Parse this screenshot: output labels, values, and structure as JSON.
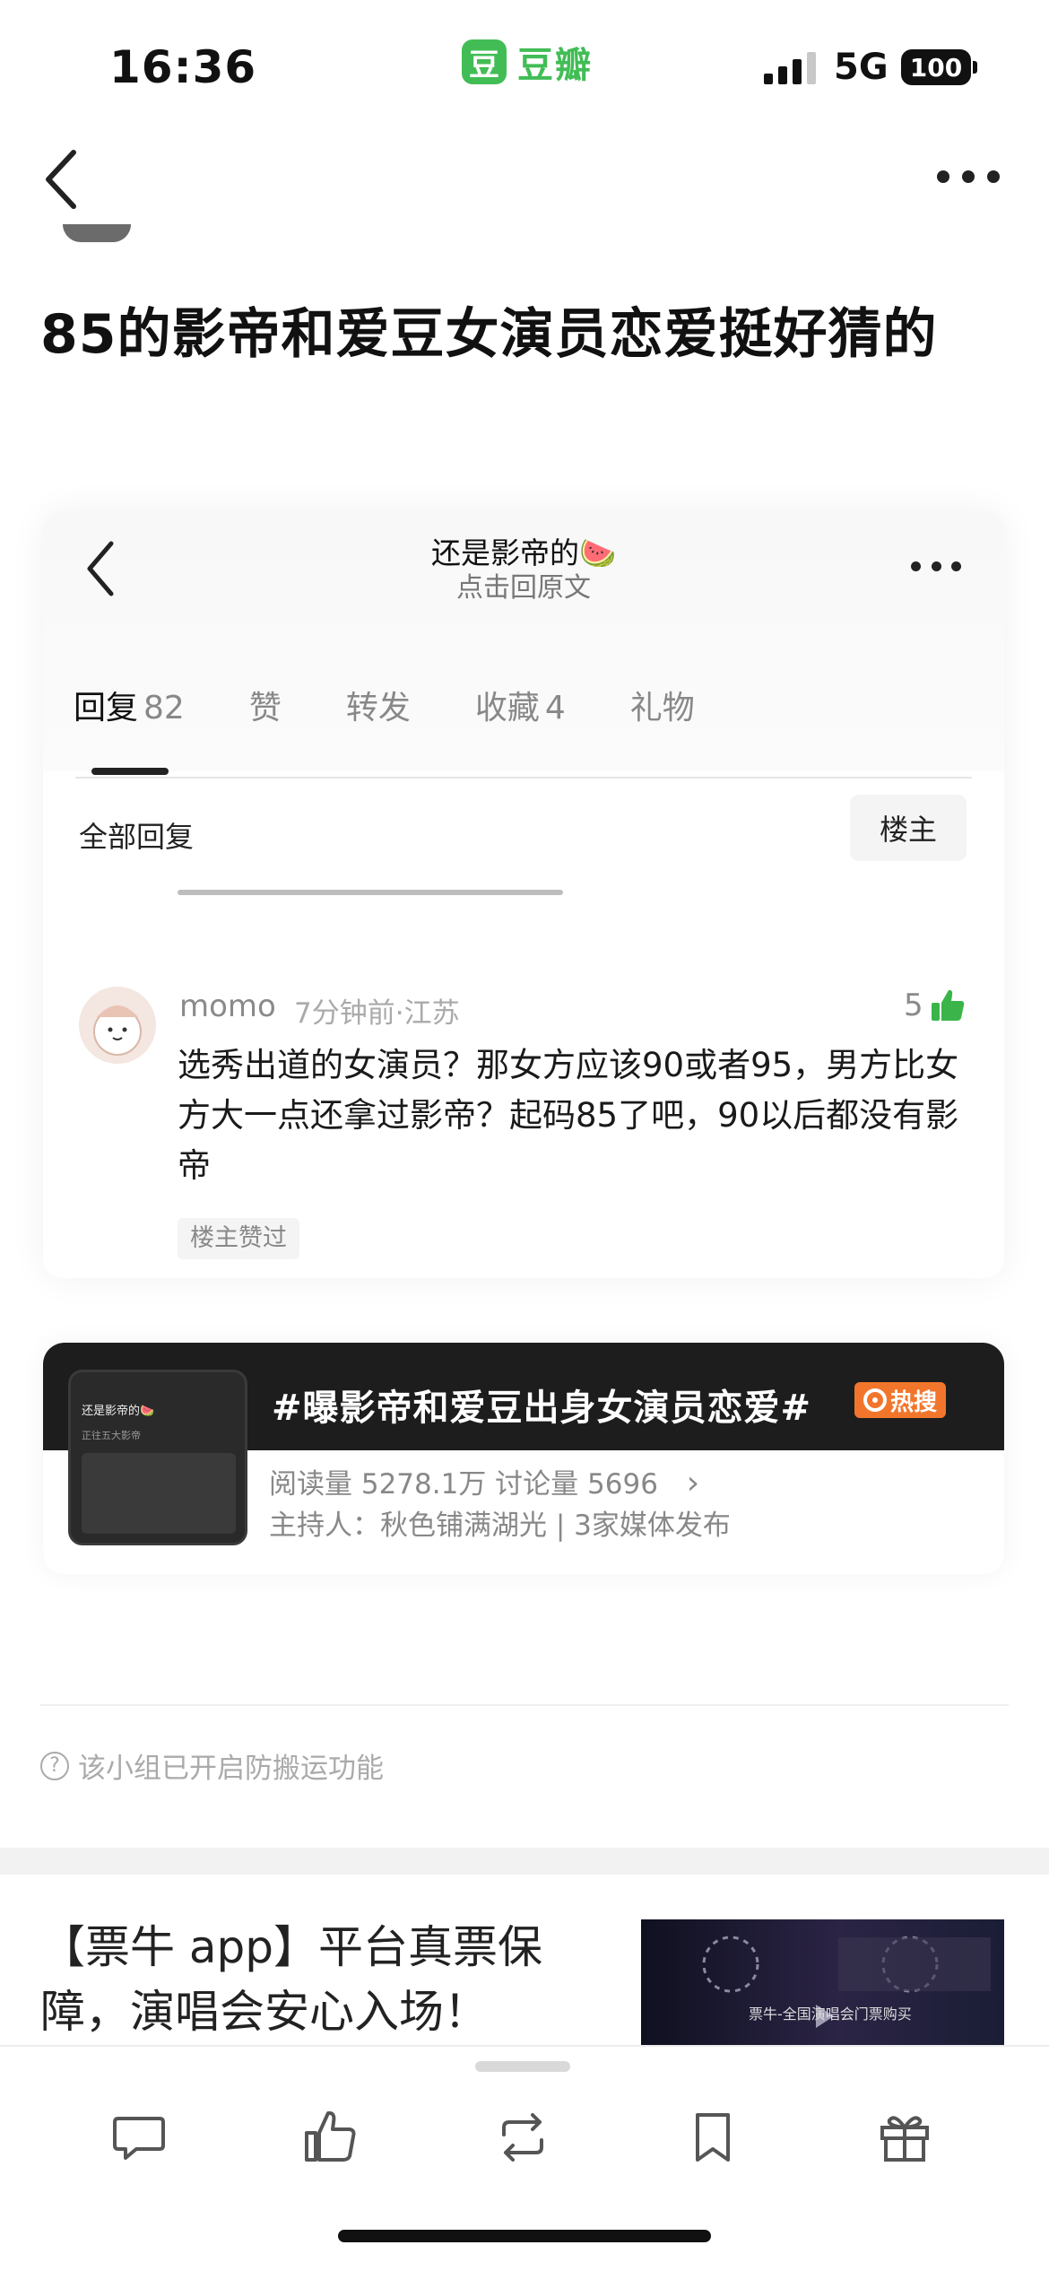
{
  "status_bar": {
    "time": "16:36",
    "app_logo_char": "豆",
    "app_name": "豆瓣",
    "network": "5G",
    "battery": "100"
  },
  "post": {
    "title": "85的影帝和爱豆女演员恋爱挺好猜的"
  },
  "screenshot": {
    "title": "还是影帝的🍉",
    "subtitle": "点击回原文",
    "tabs": [
      {
        "label": "回复",
        "count": "82"
      },
      {
        "label": "赞",
        "count": ""
      },
      {
        "label": "转发",
        "count": ""
      },
      {
        "label": "收藏",
        "count": "4"
      },
      {
        "label": "礼物",
        "count": ""
      }
    ],
    "filter_label": "全部回复",
    "filter_button": "楼主",
    "comment": {
      "author": "momo",
      "meta": "7分钟前·江苏",
      "likes": "5",
      "text": "选秀出道的女演员？那女方应该90或者95，男方比女方大一点还拿过影帝？起码85了吧，90以后都没有影帝",
      "badge": "楼主赞过"
    }
  },
  "topic": {
    "title": "#曝影帝和爱豆出身女演员恋爱#",
    "hot_label": "热搜",
    "stats": "阅读量 5278.1万  讨论量 5696",
    "arrow": "›",
    "host": "主持人：秋色铺满湖光 | 3家媒体发布",
    "thumb_title": "还是影帝的🍉",
    "thumb_sub": "正往五大影帝"
  },
  "notice": {
    "icon_char": "?",
    "text": "该小组已开启防搬运功能"
  },
  "ad": {
    "text": "【票牛 app】平台真票保障，演唱会安心入场！",
    "image_caption": "票牛-全国演唱会门票购买"
  },
  "icons": {
    "back": "chevron-left-icon",
    "more": "more-icon",
    "comment": "comment-icon",
    "like": "thumb-up-icon",
    "repost": "repost-icon",
    "bookmark": "bookmark-icon",
    "gift": "gift-icon"
  },
  "colors": {
    "brand_green": "#42bd56",
    "hot_orange": "#f1762c",
    "like_green": "#3bb54a"
  }
}
